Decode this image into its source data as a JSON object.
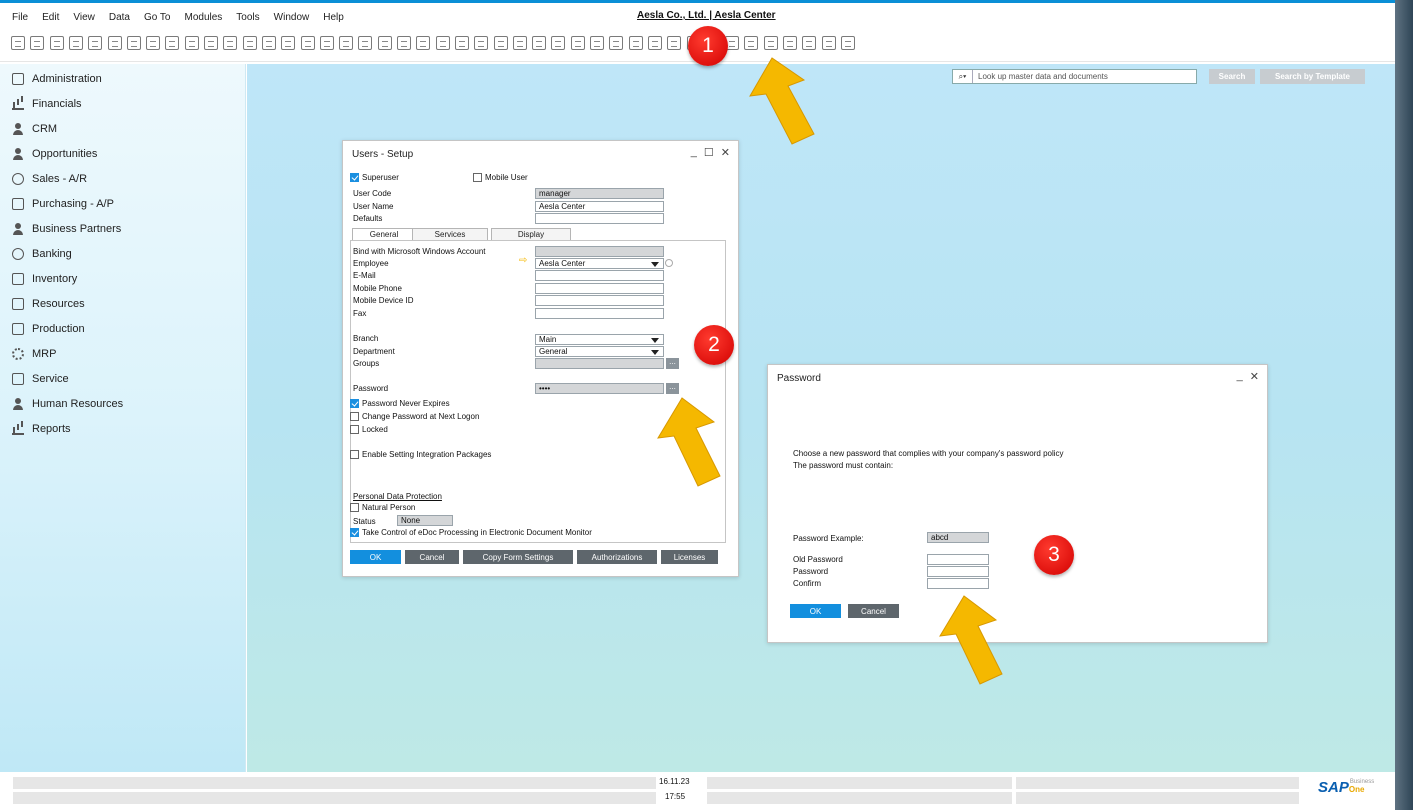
{
  "menubar": {
    "items": [
      "File",
      "Edit",
      "View",
      "Data",
      "Go To",
      "Modules",
      "Tools",
      "Window",
      "Help"
    ],
    "company": "Aesla Co., Ltd. | Aesla Center"
  },
  "sidebar": {
    "items": [
      {
        "label": "Administration",
        "icon": "administration-icon"
      },
      {
        "label": "Financials",
        "icon": "financials-icon"
      },
      {
        "label": "CRM",
        "icon": "crm-icon"
      },
      {
        "label": "Opportunities",
        "icon": "opportunities-icon"
      },
      {
        "label": "Sales - A/R",
        "icon": "sales-icon"
      },
      {
        "label": "Purchasing - A/P",
        "icon": "cart-icon"
      },
      {
        "label": "Business Partners",
        "icon": "person-icon"
      },
      {
        "label": "Banking",
        "icon": "coin-icon"
      },
      {
        "label": "Inventory",
        "icon": "inventory-icon"
      },
      {
        "label": "Resources",
        "icon": "factory-icon"
      },
      {
        "label": "Production",
        "icon": "production-icon"
      },
      {
        "label": "MRP",
        "icon": "gear-icon"
      },
      {
        "label": "Service",
        "icon": "service-icon"
      },
      {
        "label": "Human Resources",
        "icon": "hr-icon"
      },
      {
        "label": "Reports",
        "icon": "reports-icon"
      }
    ]
  },
  "search": {
    "placeholder": "Look up master data and documents",
    "search_label": "Search",
    "template_label": "Search by Template",
    "dropdown_glyph": "⌕▾"
  },
  "users_setup": {
    "title": "Users - Setup",
    "superuser": "Superuser",
    "mobile_user": "Mobile User",
    "user_code_label": "User Code",
    "user_code": "manager",
    "user_name_label": "User Name",
    "user_name": "Aesla Center",
    "defaults_label": "Defaults",
    "tabs": [
      "General",
      "Services",
      "Display"
    ],
    "bind_label": "Bind with Microsoft Windows Account",
    "employee_label": "Employee",
    "employee": "Aesla Center",
    "email_label": "E-Mail",
    "mobile_phone_label": "Mobile Phone",
    "mobile_device_label": "Mobile Device ID",
    "fax_label": "Fax",
    "branch_label": "Branch",
    "branch": "Main",
    "department_label": "Department",
    "department": "General",
    "groups_label": "Groups",
    "password_label": "Password",
    "password": "••••",
    "pwd_never_expires": "Password Never Expires",
    "change_pwd": "Change Password at Next Logon",
    "locked": "Locked",
    "enable_integration": "Enable Setting Integration Packages",
    "personal_data": "Personal Data Protection",
    "natural_person": "Natural Person",
    "status_label": "Status",
    "status": "None",
    "edoc": "Take Control of eDoc Processing in Electronic Document Monitor",
    "ok": "OK",
    "cancel": "Cancel",
    "copy_form": "Copy Form Settings",
    "authorizations": "Authorizations",
    "licenses": "Licenses",
    "ellipsis": "..."
  },
  "password_dialog": {
    "title": "Password",
    "line1": "Choose a new password that complies with your company's password policy",
    "line2": "The password must contain:",
    "example_label": "Password Example:",
    "example": "abcd",
    "old_password_label": "Old Password",
    "password_label": "Password",
    "confirm_label": "Confirm",
    "ok": "OK",
    "cancel": "Cancel"
  },
  "annotations": {
    "badge1": "1",
    "badge2": "2",
    "badge3": "3",
    "arrow_color": "#f5b800",
    "badge_color": "#e00000"
  },
  "statusbar": {
    "date": "16.11.23",
    "time": "17:55",
    "logo_sap": "SAP",
    "logo_business": "Business",
    "logo_one": "One"
  }
}
